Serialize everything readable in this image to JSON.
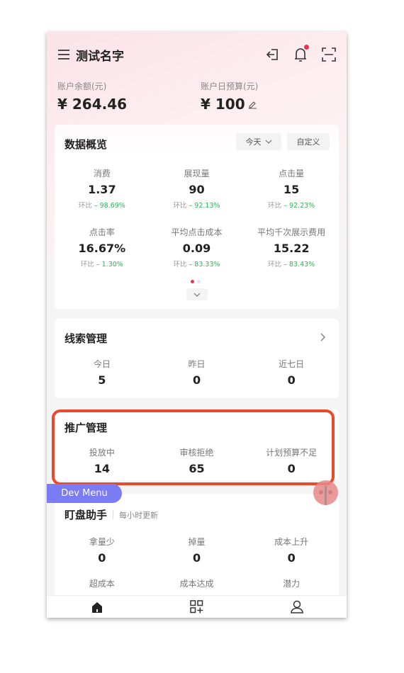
{
  "header": {
    "title": "测试名字",
    "icons": [
      "menu-icon",
      "logout-icon",
      "bell-icon",
      "scan-icon"
    ]
  },
  "account": {
    "balance_label": "账户余额(元)",
    "balance": "¥ 264.46",
    "budget_label": "账户日预算(元)",
    "budget": "¥ 100"
  },
  "overview": {
    "title": "数据概览",
    "range": "今天",
    "custom": "自定义",
    "compare_label": "环比",
    "metrics": [
      {
        "label": "消费",
        "value": "1.37",
        "change": "– 98.69%"
      },
      {
        "label": "展现量",
        "value": "90",
        "change": "– 92.13%"
      },
      {
        "label": "点击量",
        "value": "15",
        "change": "– 92.23%"
      },
      {
        "label": "点击率",
        "value": "16.67%",
        "change": "– 1.30%"
      },
      {
        "label": "平均点击成本",
        "value": "0.09",
        "change": "– 83.33%"
      },
      {
        "label": "平均千次展示费用",
        "value": "15.22",
        "change": "– 83.43%"
      }
    ]
  },
  "leads": {
    "title": "线索管理",
    "items": [
      {
        "label": "今日",
        "value": "5"
      },
      {
        "label": "昨日",
        "value": "0"
      },
      {
        "label": "近七日",
        "value": "0"
      }
    ]
  },
  "promo": {
    "title": "推广管理",
    "items": [
      {
        "label": "投放中",
        "value": "14"
      },
      {
        "label": "审核拒绝",
        "value": "65"
      },
      {
        "label": "计划预算不足",
        "value": "0"
      }
    ]
  },
  "dev_menu": "Dev Menu",
  "monitor": {
    "title": "盯盘助手",
    "subtitle": "每小时更新",
    "items": [
      {
        "label": "拿量少",
        "value": "0"
      },
      {
        "label": "掉量",
        "value": "0"
      },
      {
        "label": "成本上升",
        "value": "0"
      }
    ],
    "items2": [
      {
        "label": "超成本"
      },
      {
        "label": "成本达成"
      },
      {
        "label": "潜力"
      }
    ]
  },
  "nav": [
    "home-icon",
    "apps-add-icon",
    "user-icon"
  ],
  "colors": {
    "accent": "#e8334a",
    "positive": "#2fb457",
    "highlight": "#e84a2e",
    "dev": "#7b7bf5"
  }
}
